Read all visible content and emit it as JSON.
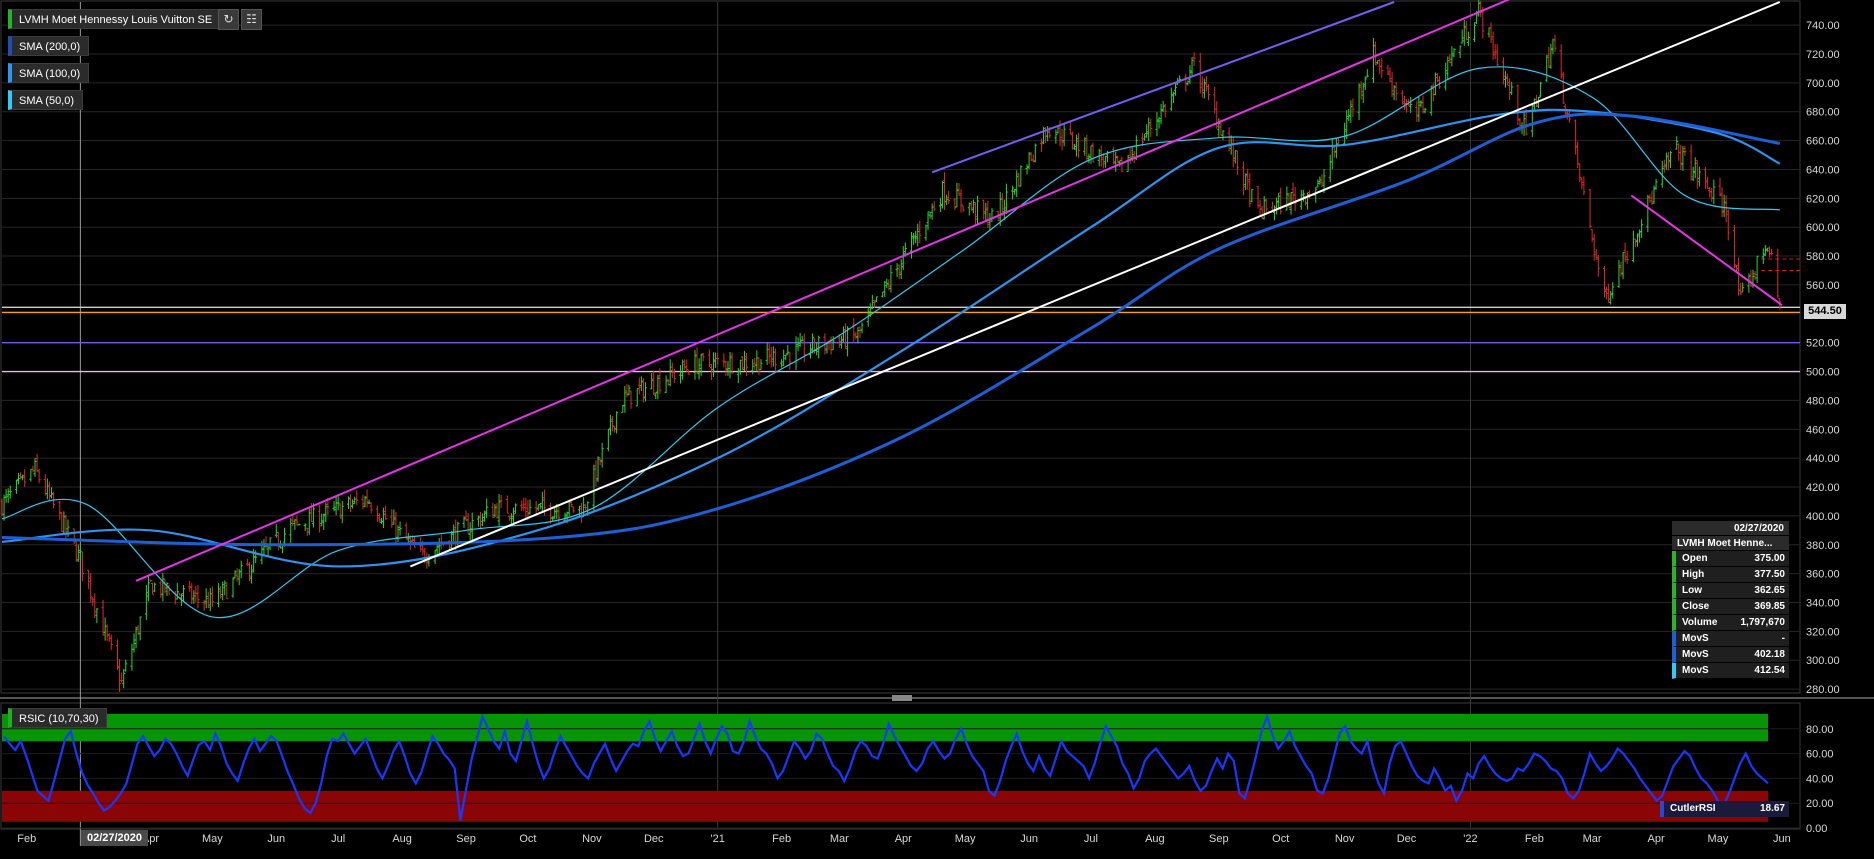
{
  "chart_title": "LVMH Moet Hennessy Louis Vuitton SE",
  "indicators": [
    "SMA (200,0)",
    "SMA (100,0)",
    "SMA (50,0)"
  ],
  "rsi_label": "RSIC (10,70,30)",
  "toolbar": {
    "refresh_icon": "refresh-icon",
    "settings_icon": "chart-settings-icon"
  },
  "current_price_label": "544.50",
  "crosshair_date": "02/27/2020",
  "info_panel": {
    "date": "02/27/2020",
    "name": "LVMH Moet Henne...",
    "rows": [
      {
        "label": "Open",
        "value": "375.00"
      },
      {
        "label": "High",
        "value": "377.50"
      },
      {
        "label": "Low",
        "value": "362.65"
      },
      {
        "label": "Close",
        "value": "369.85"
      },
      {
        "label": "Volume",
        "value": "1,797,670"
      },
      {
        "label": "MovS",
        "value": "-"
      },
      {
        "label": "MovS",
        "value": "402.18"
      },
      {
        "label": "MovS",
        "value": "412.54"
      }
    ]
  },
  "cutler": {
    "label": "CutlerRSI",
    "value": "18.67"
  },
  "colors": {
    "up": "#2bd62b",
    "down": "#e02a2a",
    "sma200": "#1f5fd6",
    "sma100": "#2f93f0",
    "sma50": "#37c8ef",
    "rsi_line": "#1838ff",
    "overbought_band": "#079407",
    "oversold_band": "#8c0505",
    "magenta_channel": "#e535e8",
    "purple_channel": "#7a5cf2",
    "white_trend": "#ffffff"
  },
  "chart_data": [
    {
      "type": "candlestick",
      "title": "LVMH Moet Hennessy Louis Vuitton SE",
      "x_tick_labels": [
        "Feb",
        "Apr",
        "May",
        "Jun",
        "Jul",
        "Aug",
        "Sep",
        "Oct",
        "Nov",
        "Dec",
        "'21",
        "Feb",
        "Mar",
        "Apr",
        "May",
        "Jun",
        "Jul",
        "Aug",
        "Sep",
        "Oct",
        "Nov",
        "Dec",
        "'22",
        "Feb",
        "Mar",
        "Apr",
        "May",
        "Jun"
      ],
      "x_start": "2020-01-20",
      "x_end": "2022-06-03",
      "y_ticks": [
        280,
        300,
        320,
        340,
        360,
        380,
        400,
        420,
        440,
        460,
        480,
        500,
        520,
        540,
        560,
        580,
        600,
        620,
        640,
        660,
        680,
        700,
        720,
        740
      ],
      "ylim": [
        278,
        756
      ],
      "price_path": [
        {
          "date": "2020-01-20",
          "close": 408
        },
        {
          "date": "2020-02-05",
          "close": 432
        },
        {
          "date": "2020-02-27",
          "close": 369.85
        },
        {
          "date": "2020-03-18",
          "close": 284
        },
        {
          "date": "2020-04-01",
          "close": 352
        },
        {
          "date": "2020-05-01",
          "close": 340
        },
        {
          "date": "2020-06-08",
          "close": 392
        },
        {
          "date": "2020-07-15",
          "close": 412
        },
        {
          "date": "2020-08-10",
          "close": 372
        },
        {
          "date": "2020-09-15",
          "close": 405
        },
        {
          "date": "2020-10-28",
          "close": 405
        },
        {
          "date": "2020-11-15",
          "close": 480
        },
        {
          "date": "2020-12-20",
          "close": 505
        },
        {
          "date": "2021-01-20",
          "close": 507
        },
        {
          "date": "2021-03-10",
          "close": 525
        },
        {
          "date": "2021-04-20",
          "close": 625
        },
        {
          "date": "2021-05-15",
          "close": 605
        },
        {
          "date": "2021-06-10",
          "close": 670
        },
        {
          "date": "2021-07-15",
          "close": 640
        },
        {
          "date": "2021-08-20",
          "close": 712
        },
        {
          "date": "2021-09-20",
          "close": 610
        },
        {
          "date": "2021-10-20",
          "close": 628
        },
        {
          "date": "2021-11-15",
          "close": 720
        },
        {
          "date": "2021-12-05",
          "close": 675
        },
        {
          "date": "2022-01-05",
          "close": 750
        },
        {
          "date": "2022-01-28",
          "close": 665
        },
        {
          "date": "2022-02-10",
          "close": 728
        },
        {
          "date": "2022-03-07",
          "close": 550
        },
        {
          "date": "2022-04-10",
          "close": 655
        },
        {
          "date": "2022-05-05",
          "close": 612
        },
        {
          "date": "2022-05-12",
          "close": 548
        },
        {
          "date": "2022-05-25",
          "close": 590
        },
        {
          "date": "2022-05-31",
          "close": 544.5
        }
      ],
      "sma50": [
        {
          "date": "2020-01-20",
          "y": 398
        },
        {
          "date": "2020-03-01",
          "y": 408
        },
        {
          "date": "2020-05-01",
          "y": 330
        },
        {
          "date": "2020-07-01",
          "y": 376
        },
        {
          "date": "2020-09-01",
          "y": 390
        },
        {
          "date": "2020-11-01",
          "y": 405
        },
        {
          "date": "2021-01-01",
          "y": 475
        },
        {
          "date": "2021-03-01",
          "y": 525
        },
        {
          "date": "2021-05-01",
          "y": 585
        },
        {
          "date": "2021-07-01",
          "y": 647
        },
        {
          "date": "2021-09-01",
          "y": 662
        },
        {
          "date": "2021-11-01",
          "y": 663
        },
        {
          "date": "2022-01-05",
          "y": 710
        },
        {
          "date": "2022-03-01",
          "y": 690
        },
        {
          "date": "2022-04-15",
          "y": 622
        },
        {
          "date": "2022-05-31",
          "y": 612
        }
      ],
      "sma100": [
        {
          "date": "2020-01-20",
          "y": 382
        },
        {
          "date": "2020-04-01",
          "y": 390
        },
        {
          "date": "2020-07-01",
          "y": 365
        },
        {
          "date": "2020-10-01",
          "y": 388
        },
        {
          "date": "2021-01-01",
          "y": 440
        },
        {
          "date": "2021-04-01",
          "y": 515
        },
        {
          "date": "2021-07-01",
          "y": 600
        },
        {
          "date": "2021-09-01",
          "y": 655
        },
        {
          "date": "2021-11-01",
          "y": 657
        },
        {
          "date": "2022-01-15",
          "y": 678
        },
        {
          "date": "2022-03-01",
          "y": 680
        },
        {
          "date": "2022-05-01",
          "y": 665
        },
        {
          "date": "2022-05-31",
          "y": 644
        }
      ],
      "sma200": [
        {
          "date": "2020-01-20",
          "y": 385
        },
        {
          "date": "2020-06-01",
          "y": 380
        },
        {
          "date": "2020-10-15",
          "y": 385
        },
        {
          "date": "2021-01-01",
          "y": 405
        },
        {
          "date": "2021-04-01",
          "y": 455
        },
        {
          "date": "2021-07-01",
          "y": 530
        },
        {
          "date": "2021-09-01",
          "y": 585
        },
        {
          "date": "2021-12-01",
          "y": 632
        },
        {
          "date": "2022-02-01",
          "y": 672
        },
        {
          "date": "2022-03-20",
          "y": 677
        },
        {
          "date": "2022-05-31",
          "y": 658
        }
      ],
      "trend_lines": [
        {
          "name": "magenta-channel-upper",
          "from": {
            "date": "2020-03-25",
            "y": 355
          },
          "to": {
            "date": "2022-01-20",
            "y": 758
          }
        },
        {
          "name": "magenta-channel-lower",
          "from": {
            "date": "2022-03-20",
            "y": 622
          },
          "to": {
            "date": "2022-06-01",
            "y": 546
          }
        },
        {
          "name": "purple-channel",
          "from": {
            "date": "2021-04-15",
            "y": 638
          },
          "to": {
            "date": "2021-11-25",
            "y": 756
          }
        },
        {
          "name": "white-trend",
          "from": {
            "date": "2020-08-05",
            "y": 365
          },
          "to": {
            "date": "2022-05-31",
            "y": 756
          }
        }
      ],
      "horizontal_levels": [
        {
          "y": 544.5,
          "color": "#cfcfcf"
        },
        {
          "y": 541,
          "color": "#f0a030"
        },
        {
          "y": 520,
          "color": "#6a5ff0"
        },
        {
          "y": 500,
          "color": "#e0b8ff"
        }
      ],
      "current_price": 544.5
    },
    {
      "type": "line",
      "title": "RSIC (10,70,30)",
      "y_ticks": [
        0,
        20,
        40,
        60,
        80
      ],
      "ylim": [
        0,
        100
      ],
      "bands": {
        "overbought": 70,
        "oversold": 30
      },
      "series": [
        {
          "name": "CutlerRSI",
          "values": [
            74,
            68,
            63,
            70,
            58,
            44,
            30,
            26,
            22,
            38,
            55,
            72,
            78,
            60,
            45,
            35,
            28,
            20,
            14,
            17,
            22,
            28,
            36,
            52,
            68,
            74,
            66,
            58,
            63,
            72,
            68,
            60,
            50,
            42,
            55,
            67,
            70,
            63,
            76,
            66,
            52,
            44,
            38,
            52,
            64,
            72,
            62,
            68,
            74,
            70,
            58,
            45,
            35,
            24,
            16,
            12,
            20,
            36,
            58,
            72,
            70,
            76,
            68,
            60,
            66,
            72,
            60,
            48,
            40,
            50,
            62,
            70,
            58,
            44,
            36,
            45,
            60,
            74,
            68,
            60,
            55,
            48,
            6,
            30,
            55,
            72,
            90,
            80,
            70,
            64,
            78,
            60,
            54,
            70,
            86,
            68,
            52,
            40,
            48,
            62,
            74,
            66,
            58,
            50,
            44,
            40,
            52,
            60,
            68,
            56,
            46,
            54,
            62,
            68,
            66,
            78,
            86,
            72,
            62,
            70,
            78,
            66,
            58,
            60,
            72,
            84,
            70,
            60,
            72,
            82,
            76,
            62,
            60,
            70,
            86,
            74,
            64,
            60,
            52,
            40,
            46,
            58,
            70,
            64,
            56,
            62,
            76,
            72,
            60,
            50,
            46,
            38,
            48,
            62,
            70,
            66,
            58,
            56,
            68,
            84,
            74,
            66,
            58,
            50,
            46,
            52,
            64,
            70,
            62,
            56,
            60,
            72,
            80,
            68,
            58,
            52,
            46,
            30,
            26,
            38,
            54,
            66,
            76,
            62,
            52,
            46,
            58,
            48,
            42,
            56,
            70,
            62,
            58,
            54,
            50,
            40,
            52,
            68,
            82,
            74,
            66,
            52,
            44,
            32,
            40,
            54,
            60,
            64,
            58,
            52,
            46,
            40,
            44,
            50,
            38,
            30,
            34,
            46,
            56,
            48,
            60,
            54,
            28,
            24,
            40,
            58,
            78,
            90,
            74,
            64,
            70,
            78,
            66,
            58,
            50,
            44,
            30,
            28,
            40,
            58,
            76,
            82,
            70,
            64,
            60,
            70,
            50,
            36,
            28,
            52,
            66,
            70,
            60,
            50,
            42,
            38,
            36,
            48,
            40,
            30,
            34,
            22,
            30,
            44,
            40,
            52,
            58,
            50,
            44,
            40,
            38,
            40,
            48,
            46,
            52,
            60,
            58,
            54,
            48,
            46,
            40,
            28,
            24,
            30,
            44,
            60,
            52,
            46,
            50,
            56,
            64,
            60,
            54,
            48,
            40,
            34,
            28,
            22,
            26,
            38,
            50,
            56,
            62,
            58,
            48,
            40,
            36,
            30,
            22,
            18,
            28,
            40,
            52,
            60,
            50,
            44,
            40,
            36
          ]
        }
      ]
    }
  ]
}
